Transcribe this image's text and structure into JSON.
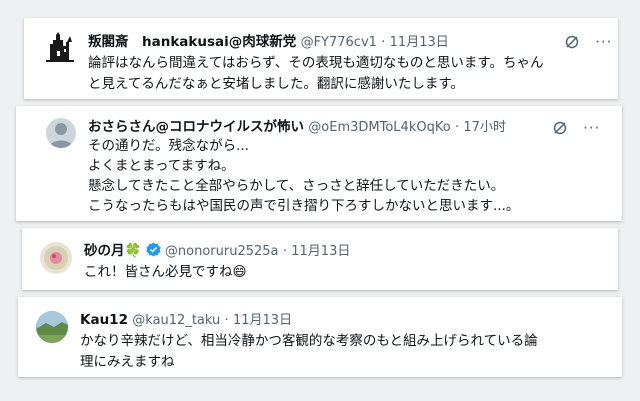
{
  "tweets": [
    {
      "name": "叛閣斎　hankakusai@肉球新党",
      "handle": "@FY776cv1",
      "time": "11月13日",
      "text": "論評はなんら間違えてはおらず、その表現も適切なものと思います。ちゃん\nと見えてるんだなぁと安堵しました。翻訳に感謝いたします。"
    },
    {
      "name": "おさらさん@コロナウイルスが怖い",
      "handle": "@oEm3DMToL4kOqKo",
      "time": "17小时",
      "text": "その通りだ。残念ながら...\nよくまとまってますね。\n懸念してきたこと全部やらかして、さっさと辞任していただきたい。\nこうなったらもはや国民の声で引き摺り下ろすしかないと思います...。"
    },
    {
      "name": "砂の月",
      "name_emoji": "🍀",
      "handle": "@nonoruru2525a",
      "time": "11月13日",
      "text": "これ！皆さん必見ですね",
      "text_emoji": "😄"
    },
    {
      "name": "Kau12",
      "handle": "@kau12_taku",
      "time": "11月13日",
      "text": "かなり辛辣だけど、相当冷静かつ客観的な考察のもと組み上げられている論\n理にみえますね"
    }
  ],
  "sep": "·",
  "more_label": "···",
  "colors": {
    "verified": "#1d9bf0",
    "grok": "#536471",
    "meta": "#536471"
  }
}
